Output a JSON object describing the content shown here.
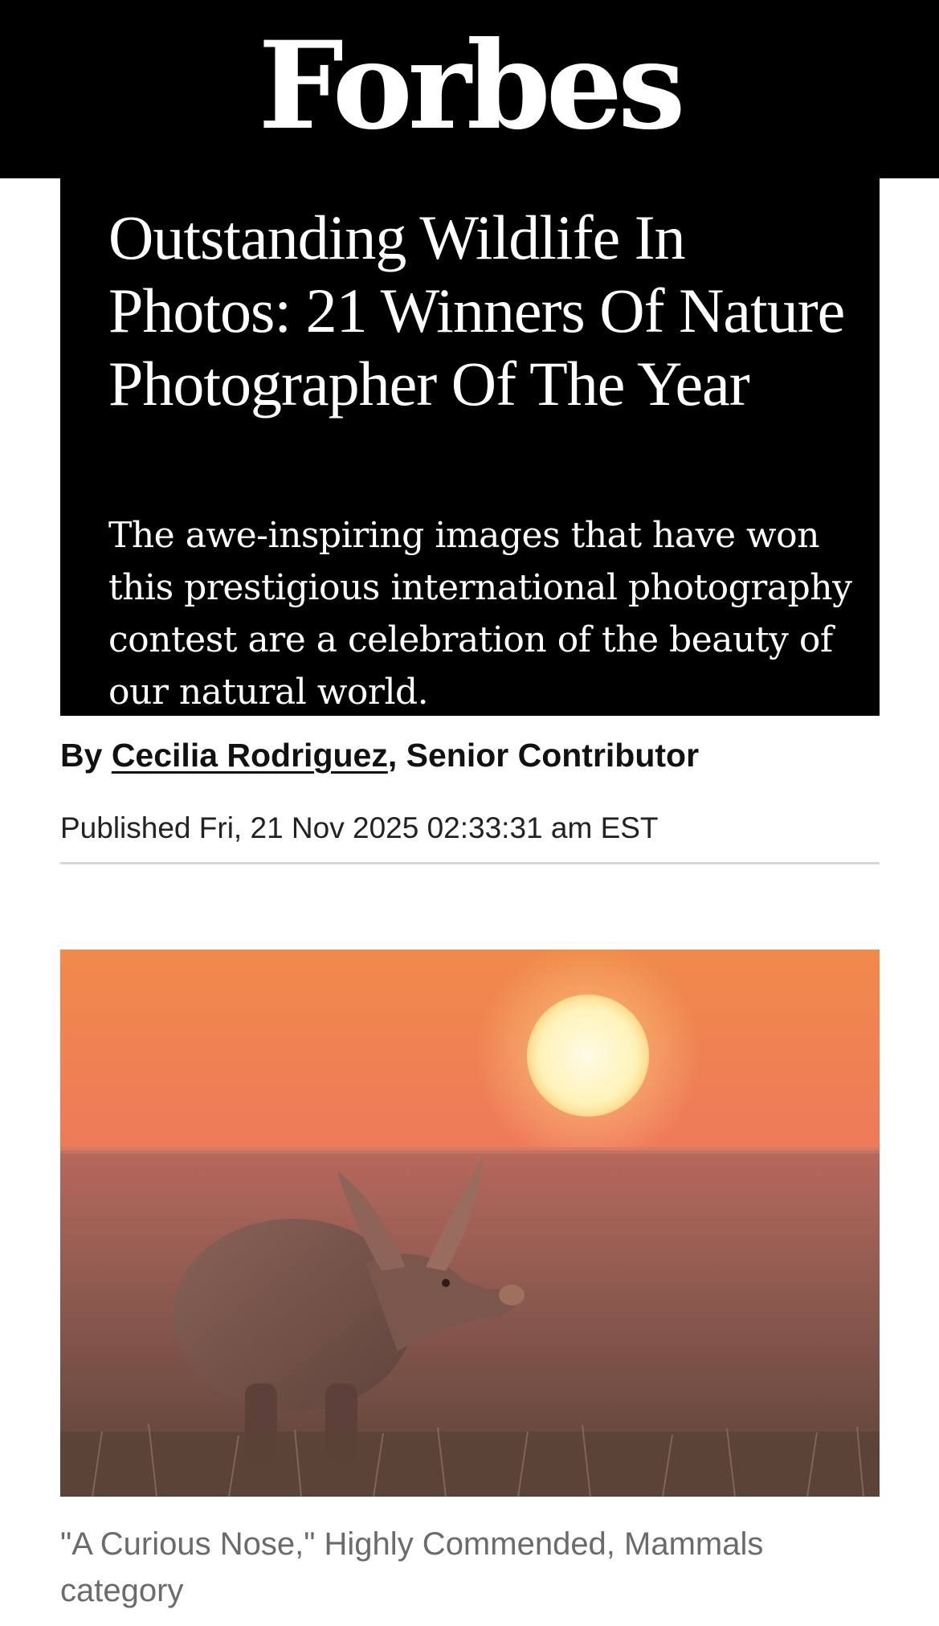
{
  "masthead": {
    "logo_text": "Forbes"
  },
  "article": {
    "headline": "Outstanding Wildlife In Photos: 21 Winners Of Nature Photographer Of The Year",
    "dek": "The awe-inspiring images that have won this prestigious international photography contest are a celebration of the beauty of our natural world.",
    "byline": {
      "prefix": "By",
      "author": "Cecilia Rodriguez",
      "role": ", Senior Contributor"
    },
    "published": "Published Fri, 21 Nov 2025 02:33:31 am EST",
    "image": {
      "subject": "aardvark-at-sunset-photo"
    },
    "caption": "\"A Curious Nose,\" Highly Commended, Mammals category"
  },
  "colors": {
    "masthead_bg": "#000000",
    "headline_box_bg": "#000000",
    "text_on_dark": "#ffffff",
    "caption_gray": "#6b6b6b",
    "divider": "#d6d6d6"
  }
}
